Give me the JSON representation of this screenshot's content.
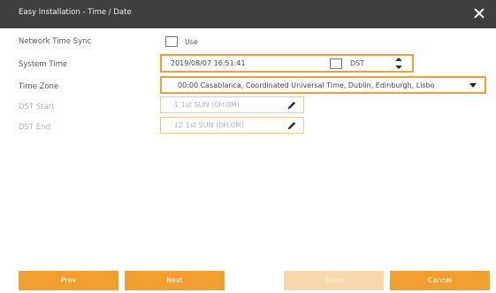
{
  "dialog": {
    "title": "Easy Installation - Time / Date"
  },
  "network_time_sync": {
    "label": "Network Time Sync",
    "checkbox_label": "Use",
    "checked": false
  },
  "system_time": {
    "label": "System Time",
    "value": "2019/08/07 16:51:41",
    "dst_label": "DST",
    "dst_checked": false
  },
  "time_zone": {
    "label": "Time Zone",
    "value": "00:00 Casablanca, Coordinated Universal Time, Dublin, Edinburgh, Lisbo"
  },
  "dst_start": {
    "label": "DST Start",
    "value": "1 1st SUN (0H:0M)"
  },
  "dst_end": {
    "label": "DST End",
    "value": "12 1st SUN (0H:0M)"
  },
  "buttons": {
    "prev": "Prev",
    "next": "Next",
    "save": "Save",
    "cancel": "Cancel"
  },
  "colors": {
    "accent": "#f0a02e",
    "titlebar": "#3f3f3f",
    "disabled_button": "#f6d8aa"
  }
}
